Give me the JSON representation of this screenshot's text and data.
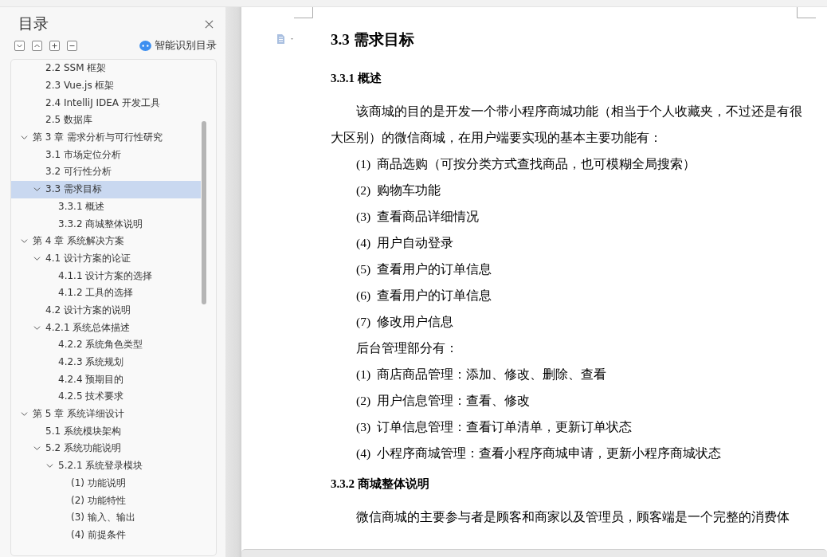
{
  "sidebar": {
    "title": "目录",
    "ai_toc_label": "智能识别目录",
    "continued_items": [
      {
        "label": "2.2 SSM 框架"
      },
      {
        "label": "2.3 Vue.js 框架"
      },
      {
        "label": "2.4 IntelliJ IDEA 开发工具"
      },
      {
        "label": "2.5  数据库"
      }
    ],
    "items": [
      {
        "label": "第 3 章  需求分析与可行性研究",
        "expanded": true,
        "selected": false,
        "children": [
          {
            "label": "3.1  市场定位分析",
            "selected": false
          },
          {
            "label": "3.2  可行性分析",
            "selected": false
          },
          {
            "label": "3.3  需求目标",
            "expanded": true,
            "selected": true,
            "children": [
              {
                "label": "3.3.1  概述",
                "selected": false
              },
              {
                "label": "3.3.2  商城整体说明",
                "selected": false
              }
            ]
          }
        ]
      },
      {
        "label": "第 4 章  系统解决方案",
        "expanded": true,
        "selected": false,
        "children": [
          {
            "label": "4.1  设计方案的论证",
            "expanded": true,
            "selected": false,
            "children": [
              {
                "label": "4.1.1  设计方案的选择",
                "selected": false
              },
              {
                "label": "4.1.2  工具的选择",
                "selected": false
              }
            ]
          },
          {
            "label": "4.2  设计方案的说明",
            "selected": false
          },
          {
            "label": "4.2.1  系统总体描述",
            "expanded": true,
            "selected": false,
            "children": [
              {
                "label": "4.2.2  系统角色类型",
                "selected": false
              },
              {
                "label": "4.2.3  系统规划",
                "selected": false
              },
              {
                "label": "4.2.4  预期目的",
                "selected": false
              },
              {
                "label": "4.2.5  技术要求",
                "selected": false
              }
            ]
          }
        ]
      },
      {
        "label": "第 5 章  系统详细设计",
        "expanded": true,
        "selected": false,
        "children": [
          {
            "label": "5.1  系统模块架构",
            "selected": false
          },
          {
            "label": "5.2  系统功能说明",
            "expanded": true,
            "selected": false,
            "children": [
              {
                "label": "5.2.1  系统登录模块",
                "expanded": true,
                "selected": false,
                "children": [
                  {
                    "label": "(1)  功能说明",
                    "selected": false
                  },
                  {
                    "label": "(2)  功能特性",
                    "selected": false
                  },
                  {
                    "label": "(3)  输入、输出",
                    "selected": false
                  },
                  {
                    "label": "(4)  前提条件",
                    "selected": false
                  }
                ]
              }
            ]
          }
        ]
      }
    ]
  },
  "document": {
    "heading": "3.3  需求目标",
    "blocks": [
      {
        "kind": "subheading",
        "text": "3.3.1  概述"
      },
      {
        "kind": "paragraph",
        "text": "该商城的目的是开发一个带小程序商城功能（相当于个人收藏夹，不过还是有很大区别）的微信商城，在用户端要实现的基本主要功能有："
      },
      {
        "kind": "list_item",
        "number": "(1)",
        "text": "商品选购（可按分类方式查找商品，也可模糊全局搜索）"
      },
      {
        "kind": "list_item",
        "number": "(2)",
        "text": "购物车功能"
      },
      {
        "kind": "list_item",
        "number": "(3)",
        "text": "查看商品详细情况"
      },
      {
        "kind": "list_item",
        "number": "(4)",
        "text": "用户自动登录"
      },
      {
        "kind": "list_item",
        "number": "(5)",
        "text": "查看用户的订单信息"
      },
      {
        "kind": "list_item",
        "number": "(6)",
        "text": "查看用户的订单信息"
      },
      {
        "kind": "list_item",
        "number": "(7)",
        "text": "修改用户信息"
      },
      {
        "kind": "line",
        "text": "后台管理部分有："
      },
      {
        "kind": "list_item",
        "number": "(1)",
        "text": "商店商品管理：添加、修改、删除、查看"
      },
      {
        "kind": "list_item",
        "number": "(2)",
        "text": "用户信息管理：查看、修改"
      },
      {
        "kind": "list_item",
        "number": "(3)",
        "text": "订单信息管理：查看订单清单，更新订单状态"
      },
      {
        "kind": "list_item",
        "number": "(4)",
        "text": "小程序商城管理：查看小程序商城申请，更新小程序商城状态"
      },
      {
        "kind": "subheading",
        "text": "3.3.2  商城整体说明"
      },
      {
        "kind": "paragraph",
        "text": "微信商城的主要参与者是顾客和商家以及管理员，顾客端是一个完整的消费体"
      }
    ]
  }
}
